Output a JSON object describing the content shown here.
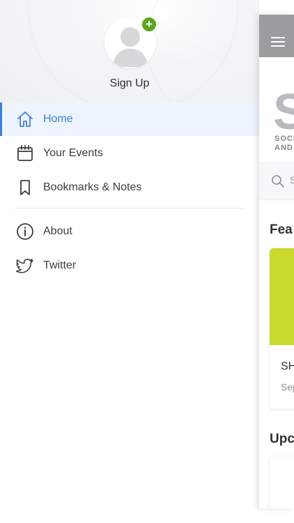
{
  "drawer": {
    "signup_label": "Sign Up",
    "avatar_badge": "+",
    "items": [
      {
        "label": "Home",
        "icon": "home-icon",
        "active": true
      },
      {
        "label": "Your Events",
        "icon": "calendar-icon",
        "active": false
      },
      {
        "label": "Bookmarks & Notes",
        "icon": "bookmark-icon",
        "active": false
      },
      {
        "label": "About",
        "icon": "info-icon",
        "active": false
      },
      {
        "label": "Twitter",
        "icon": "twitter-icon",
        "active": false
      }
    ]
  },
  "main": {
    "logo_letter": "S",
    "logo_line1": "SOCI",
    "logo_line2": "AND",
    "search_placeholder_fragment": "S",
    "featured_title_fragment": "Fea",
    "featured_card_title_fragment": "SH",
    "featured_card_date_fragment": "Sep",
    "upcoming_title_fragment": "Upc"
  },
  "colors": {
    "accent": "#3d7fdc",
    "active_bg": "#eef4fd",
    "badge": "#5ba61e",
    "topbar": "#9a9c9e",
    "feature_image": "#c9da2f"
  }
}
